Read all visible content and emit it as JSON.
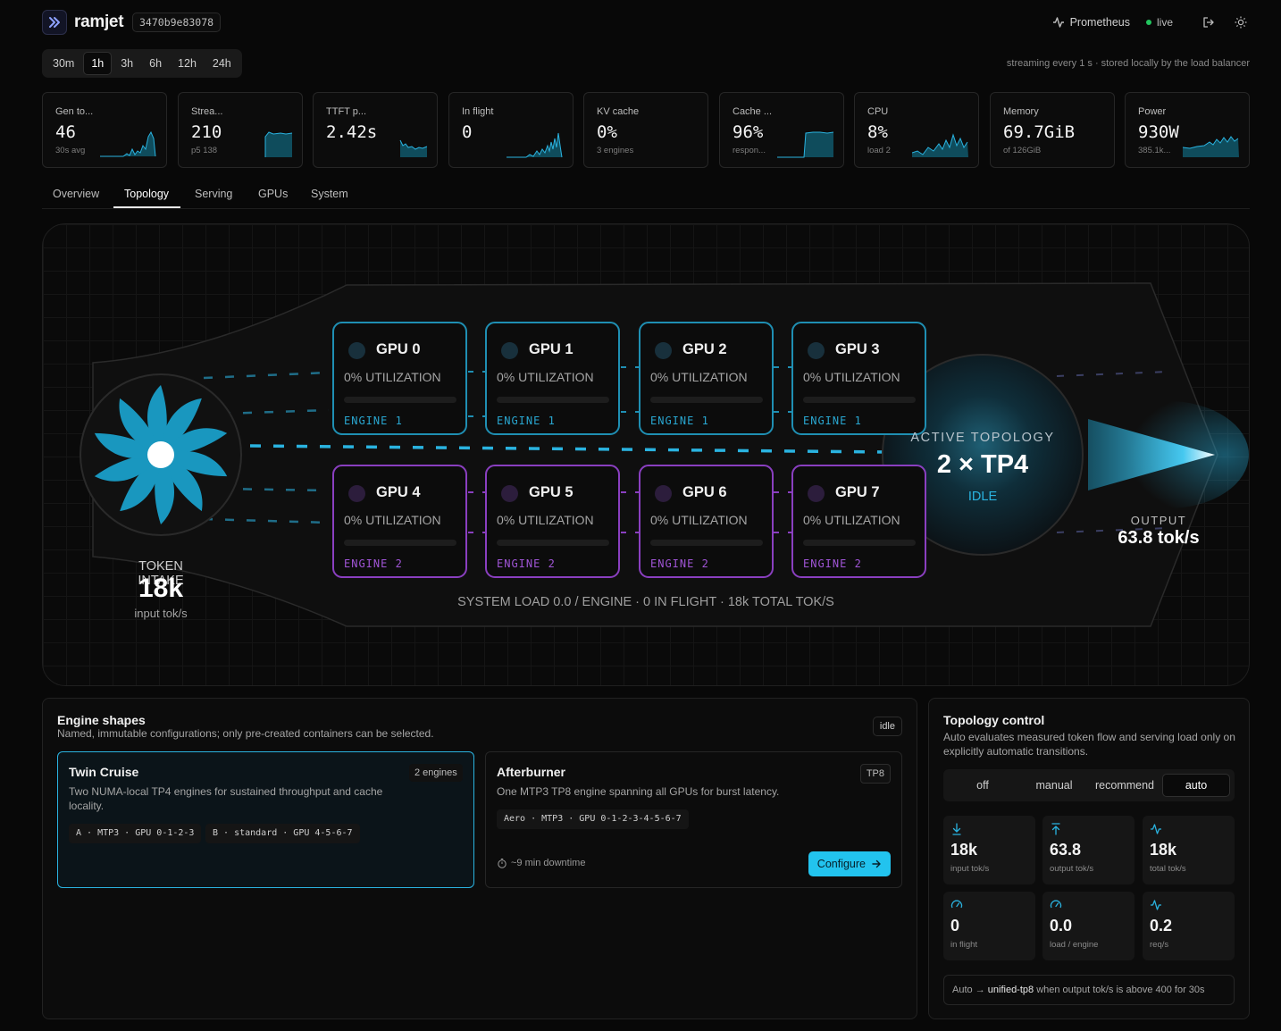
{
  "header": {
    "brand": "ramjet",
    "build_id": "3470b9e83078",
    "prometheus_label": "Prometheus",
    "live_label": "live"
  },
  "time_range": {
    "options": [
      "30m",
      "1h",
      "3h",
      "6h",
      "12h",
      "24h"
    ],
    "selected": "1h"
  },
  "stream_note": "streaming every 1 s · stored locally by the load balancer",
  "stat_cards": [
    {
      "label": "Gen to...",
      "value": "46",
      "sub": "30s avg"
    },
    {
      "label": "Strea...",
      "value": "210",
      "sub": "p5 138"
    },
    {
      "label": "TTFT p...",
      "value": "2.42s",
      "sub": ""
    },
    {
      "label": "In flight",
      "value": "0",
      "sub": ""
    },
    {
      "label": "KV cache",
      "value": "0%",
      "sub": "3 engines"
    },
    {
      "label": "Cache ...",
      "value": "96%",
      "sub": "respon..."
    },
    {
      "label": "CPU",
      "value": "8%",
      "sub": "load 2"
    },
    {
      "label": "Memory",
      "value": "69.7GiB",
      "sub": "of 126GiB"
    },
    {
      "label": "Power",
      "value": "930W",
      "sub": "385.1k..."
    }
  ],
  "tabs": [
    "Overview",
    "Topology",
    "Serving",
    "GPUs",
    "System"
  ],
  "active_tab": "Topology",
  "topology": {
    "gpus": [
      {
        "name": "GPU 0",
        "util": "0% UTILIZATION",
        "engine": "ENGINE 1"
      },
      {
        "name": "GPU 1",
        "util": "0% UTILIZATION",
        "engine": "ENGINE 1"
      },
      {
        "name": "GPU 2",
        "util": "0% UTILIZATION",
        "engine": "ENGINE 1"
      },
      {
        "name": "GPU 3",
        "util": "0% UTILIZATION",
        "engine": "ENGINE 1"
      },
      {
        "name": "GPU 4",
        "util": "0% UTILIZATION",
        "engine": "ENGINE 2"
      },
      {
        "name": "GPU 5",
        "util": "0% UTILIZATION",
        "engine": "ENGINE 2"
      },
      {
        "name": "GPU 6",
        "util": "0% UTILIZATION",
        "engine": "ENGINE 2"
      },
      {
        "name": "GPU 7",
        "util": "0% UTILIZATION",
        "engine": "ENGINE 2"
      }
    ],
    "intake_label": "TOKEN INTAKE",
    "intake_value": "18k",
    "intake_sub": "input tok/s",
    "active_label": "ACTIVE TOPOLOGY",
    "active_value": "2 × TP4",
    "active_status": "IDLE",
    "output_label": "OUTPUT",
    "output_value": "63.8 tok/s",
    "system_load": "SYSTEM LOAD 0.0 / ENGINE · 0 IN FLIGHT · 18k TOTAL TOK/S",
    "colors": {
      "engine1": "#1f8fb3",
      "engine2": "#8a3fc0",
      "accent": "#2ab3e0"
    }
  },
  "engine_shapes": {
    "title": "Engine shapes",
    "subtitle": "Named, immutable configurations; only pre-created containers can be selected.",
    "status": "idle",
    "shapes": [
      {
        "name": "Twin Cruise",
        "badge": "2 engines",
        "description": "Two NUMA-local TP4 engines for sustained throughput and cache locality.",
        "chips": [
          "A · MTP3 · GPU 0-1-2-3",
          "B · standard · GPU 4-5-6-7"
        ]
      },
      {
        "name": "Afterburner",
        "badge": "TP8",
        "description": "One MTP3 TP8 engine spanning all GPUs for burst latency.",
        "chips": [
          "Aero · MTP3 · GPU 0-1-2-3-4-5-6-7"
        ],
        "downtime": "~9 min downtime",
        "action": "Configure"
      }
    ]
  },
  "topology_control": {
    "title": "Topology control",
    "subtitle": "Auto evaluates measured token flow and serving load only on explicitly automatic transitions.",
    "modes": [
      "off",
      "manual",
      "recommend",
      "auto"
    ],
    "selected_mode": "auto",
    "metrics": [
      {
        "icon": "arrow-down-icon",
        "value": "18k",
        "label": "input tok/s"
      },
      {
        "icon": "arrow-up-icon",
        "value": "63.8",
        "label": "output tok/s"
      },
      {
        "icon": "activity-icon",
        "value": "18k",
        "label": "total tok/s"
      },
      {
        "icon": "gauge-icon",
        "value": "0",
        "label": "in flight"
      },
      {
        "icon": "gauge-icon",
        "value": "0.0",
        "label": "load / engine"
      },
      {
        "icon": "activity-icon",
        "value": "0.2",
        "label": "req/s"
      }
    ],
    "rule_prefix": "Auto",
    "rule_target": "unified-tp8",
    "rule_suffix": "when output tok/s is above 400 for 30s"
  }
}
